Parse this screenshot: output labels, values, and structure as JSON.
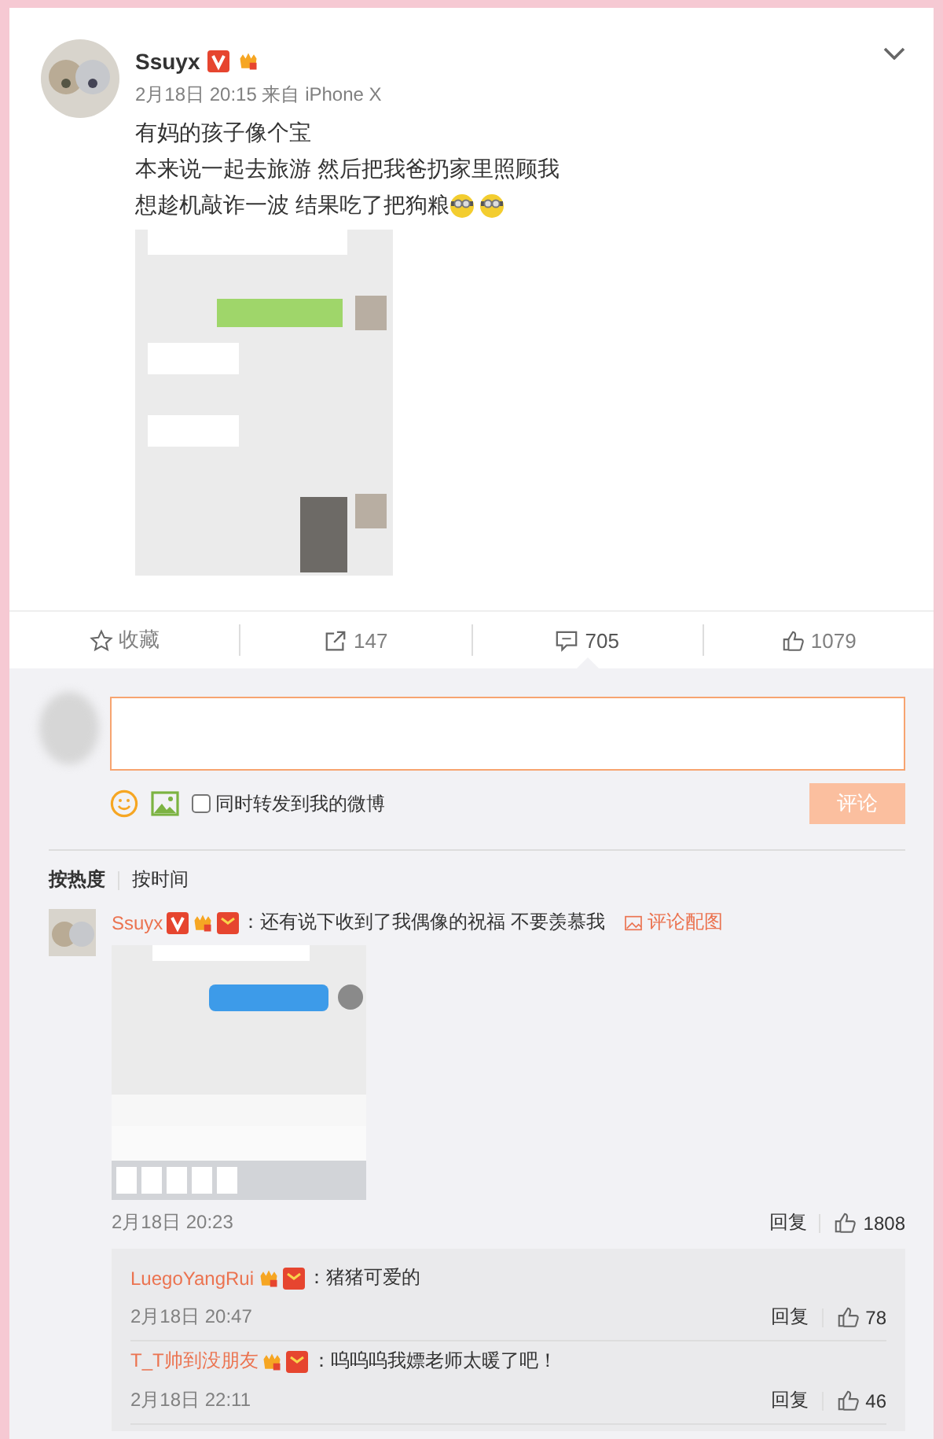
{
  "post": {
    "author": "Ssuyx",
    "time": "2月18日 20:15",
    "source": "来自 iPhone X",
    "lines": [
      "有妈的孩子像个宝",
      "本来说一起去旅游 然后把我爸扔家里照顾我",
      "想趁机敲诈一波 结果吃了把狗粮"
    ],
    "image": {
      "kind": "picture"
    }
  },
  "actions": [
    {
      "kind": "favorite",
      "label": "收藏",
      "selected": false
    },
    {
      "kind": "repost",
      "label": "147",
      "selected": false
    },
    {
      "kind": "comment",
      "label": "705",
      "selected": true
    },
    {
      "kind": "like",
      "label": "1079",
      "selected": false
    }
  ],
  "composer": {
    "repost_checkbox": {
      "label": "同时转发到我的微博",
      "checked": false
    },
    "submit": {
      "label": "评论",
      "disabled": true
    }
  },
  "sort_tabs": [
    {
      "label": "按热度",
      "selected": true
    },
    {
      "label": "按时间",
      "selected": false
    }
  ],
  "comments": [
    {
      "author": "Ssuyx",
      "text": "：还有说下收到了我偶像的祝福 不要羡慕我",
      "image_link": "评论配图",
      "image": {
        "kind": "picture"
      },
      "time": "2月18日 20:23",
      "reply": "回复",
      "likes": "1808",
      "replies": [
        {
          "author": "LuegoYangRui",
          "text": "：猪猪可爱的",
          "time": "2月18日 20:47",
          "reply": "回复",
          "likes": "78"
        },
        {
          "author": "T_T帅到没朋友",
          "text": "：呜呜呜我嫖老师太暖了吧！",
          "time": "2月18日 22:11",
          "reply": "回复",
          "likes": "46"
        }
      ]
    }
  ]
}
